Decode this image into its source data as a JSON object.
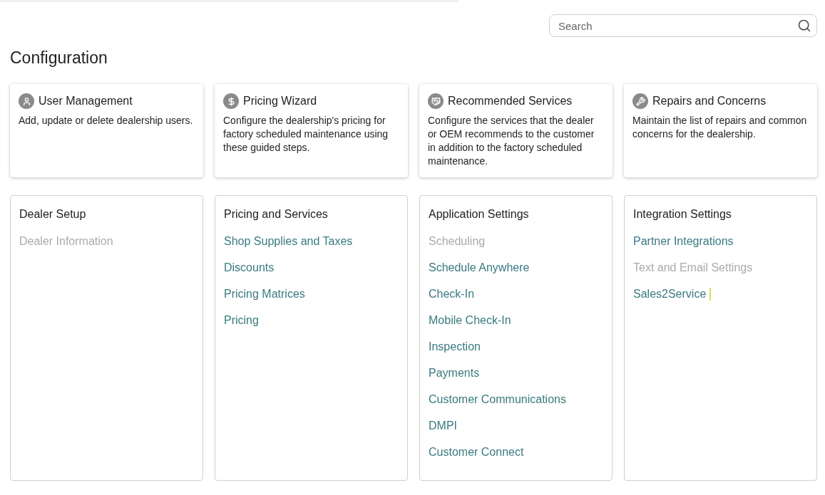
{
  "search": {
    "placeholder": "Search"
  },
  "title": "Configuration",
  "cards": [
    {
      "kind": "user",
      "title": "User Management",
      "description": "Add, update or delete dealership users."
    },
    {
      "kind": "pricing",
      "title": "Pricing Wizard",
      "description": "Configure the dealership's pricing for factory scheduled maintenance using these guided steps."
    },
    {
      "kind": "services",
      "title": "Recommended Services",
      "description": "Configure the services that the dealer or OEM recommends to the customer in addition to the factory scheduled maintenance."
    },
    {
      "kind": "repairs",
      "title": "Repairs and Concerns",
      "description": "Maintain the list of repairs and common concerns for the dealership."
    }
  ],
  "sections": [
    {
      "title": "Dealer Setup",
      "items": [
        {
          "label": "Dealer Information",
          "disabled": true,
          "marked": false
        }
      ]
    },
    {
      "title": "Pricing and Services",
      "items": [
        {
          "label": "Shop Supplies and Taxes",
          "disabled": false,
          "marked": false
        },
        {
          "label": "Discounts",
          "disabled": false,
          "marked": false
        },
        {
          "label": "Pricing Matrices",
          "disabled": false,
          "marked": false
        },
        {
          "label": "Pricing",
          "disabled": false,
          "marked": false
        }
      ]
    },
    {
      "title": "Application Settings",
      "items": [
        {
          "label": "Scheduling",
          "disabled": true,
          "marked": false
        },
        {
          "label": "Schedule Anywhere",
          "disabled": false,
          "marked": false
        },
        {
          "label": "Check-In",
          "disabled": false,
          "marked": false
        },
        {
          "label": "Mobile Check-In",
          "disabled": false,
          "marked": false
        },
        {
          "label": "Inspection",
          "disabled": false,
          "marked": false
        },
        {
          "label": "Payments",
          "disabled": false,
          "marked": false
        },
        {
          "label": "Customer Communications",
          "disabled": false,
          "marked": false
        },
        {
          "label": "DMPI",
          "disabled": false,
          "marked": false
        },
        {
          "label": "Customer Connect",
          "disabled": false,
          "marked": false
        }
      ]
    },
    {
      "title": "Integration Settings",
      "items": [
        {
          "label": "Partner Integrations",
          "disabled": false,
          "marked": false
        },
        {
          "label": "Text and Email Settings",
          "disabled": true,
          "marked": false
        },
        {
          "label": "Sales2Service",
          "disabled": false,
          "marked": true
        }
      ]
    }
  ]
}
